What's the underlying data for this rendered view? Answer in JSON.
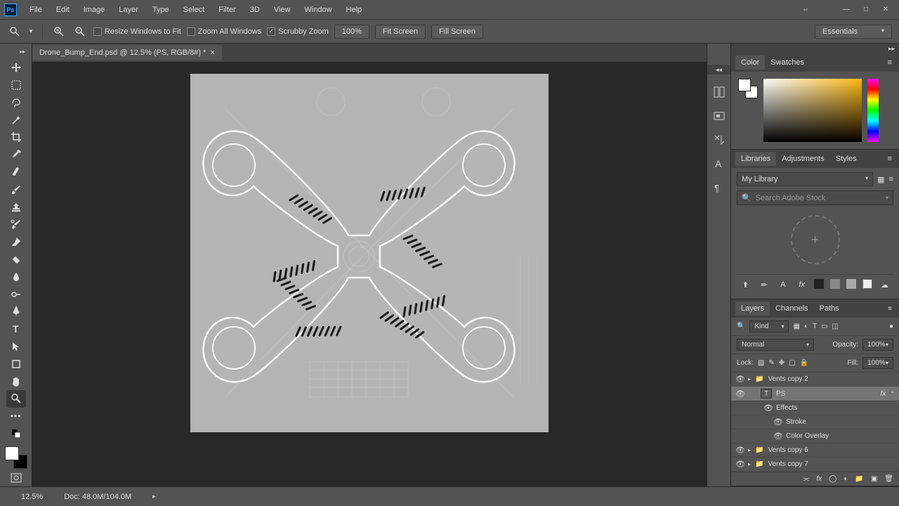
{
  "app": {
    "logo": "Ps"
  },
  "menu": [
    "File",
    "Edit",
    "Image",
    "Layer",
    "Type",
    "Select",
    "Filter",
    "3D",
    "View",
    "Window",
    "Help"
  ],
  "winctrls": {
    "min": "—",
    "max": "□",
    "close": "✕",
    "restore": "⇔"
  },
  "options": {
    "resize": "Resize Windows to Fit",
    "zoomall": "Zoom All Windows",
    "scrubby": "Scrubby Zoom",
    "zoom_pct": "100%",
    "fit": "Fit Screen",
    "fill": "Fill Screen",
    "workspace": "Essentials"
  },
  "doc": {
    "title": "Drone_Bump_End.psd @ 12.5% (PS, RGB/8#) *"
  },
  "panels": {
    "color": {
      "tab1": "Color",
      "tab2": "Swatches"
    },
    "lib": {
      "tab1": "Libraries",
      "tab2": "Adjustments",
      "tab3": "Styles",
      "dd": "My Library",
      "search": "Search Adobe Stock"
    },
    "layers": {
      "tab1": "Layers",
      "tab2": "Channels",
      "tab3": "Paths",
      "kind": "Kind",
      "blend": "Normal",
      "opacity_lbl": "Opacity:",
      "opacity": "100%",
      "lock_lbl": "Lock:",
      "fill_lbl": "Fill:",
      "fill": "100%",
      "items": [
        {
          "name": "Vents copy 2",
          "type": "folder"
        },
        {
          "name": "PS",
          "type": "text",
          "sel": true,
          "fx": true
        },
        {
          "name": "Effects",
          "type": "fxhead"
        },
        {
          "name": "Stroke",
          "type": "fx"
        },
        {
          "name": "Color Overlay",
          "type": "fx"
        },
        {
          "name": "Vents copy 6",
          "type": "folder"
        },
        {
          "name": "Vents copy 7",
          "type": "folder"
        }
      ]
    }
  },
  "status": {
    "zoom": "12.5%",
    "doc": "Doc: 48.0M/104.0M"
  }
}
